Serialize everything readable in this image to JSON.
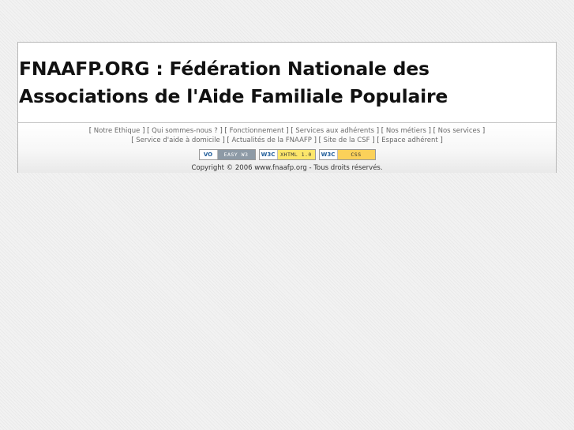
{
  "header": {
    "title": "FNAAFP.ORG : Fédération Nationale des Associations de l'Aide Familiale Populaire"
  },
  "nav": {
    "line1": [
      "Notre Ethique",
      "Qui sommes-nous ?",
      "Fonctionnement",
      "Services aux adhérents",
      "Nos métiers",
      "Nos services"
    ],
    "line2": [
      "Service d'aide à domicile",
      "Actualités de la FNAAFP",
      "Site de la CSF",
      "Espace adhérent"
    ]
  },
  "badges": [
    {
      "logo": "VO",
      "text": "EASY W3"
    },
    {
      "logo": "W3C",
      "text": "XHTML 1.0"
    },
    {
      "logo": "W3C",
      "text": "CSS"
    }
  ],
  "footer": {
    "copyright": "Copyright © 2006 www.fnaafp.org - Tous droits réservés."
  },
  "colors": {
    "background": "#f2f2f2",
    "panel": "#ffffff",
    "border": "#b8b8b8",
    "link": "#6a6a6a"
  }
}
